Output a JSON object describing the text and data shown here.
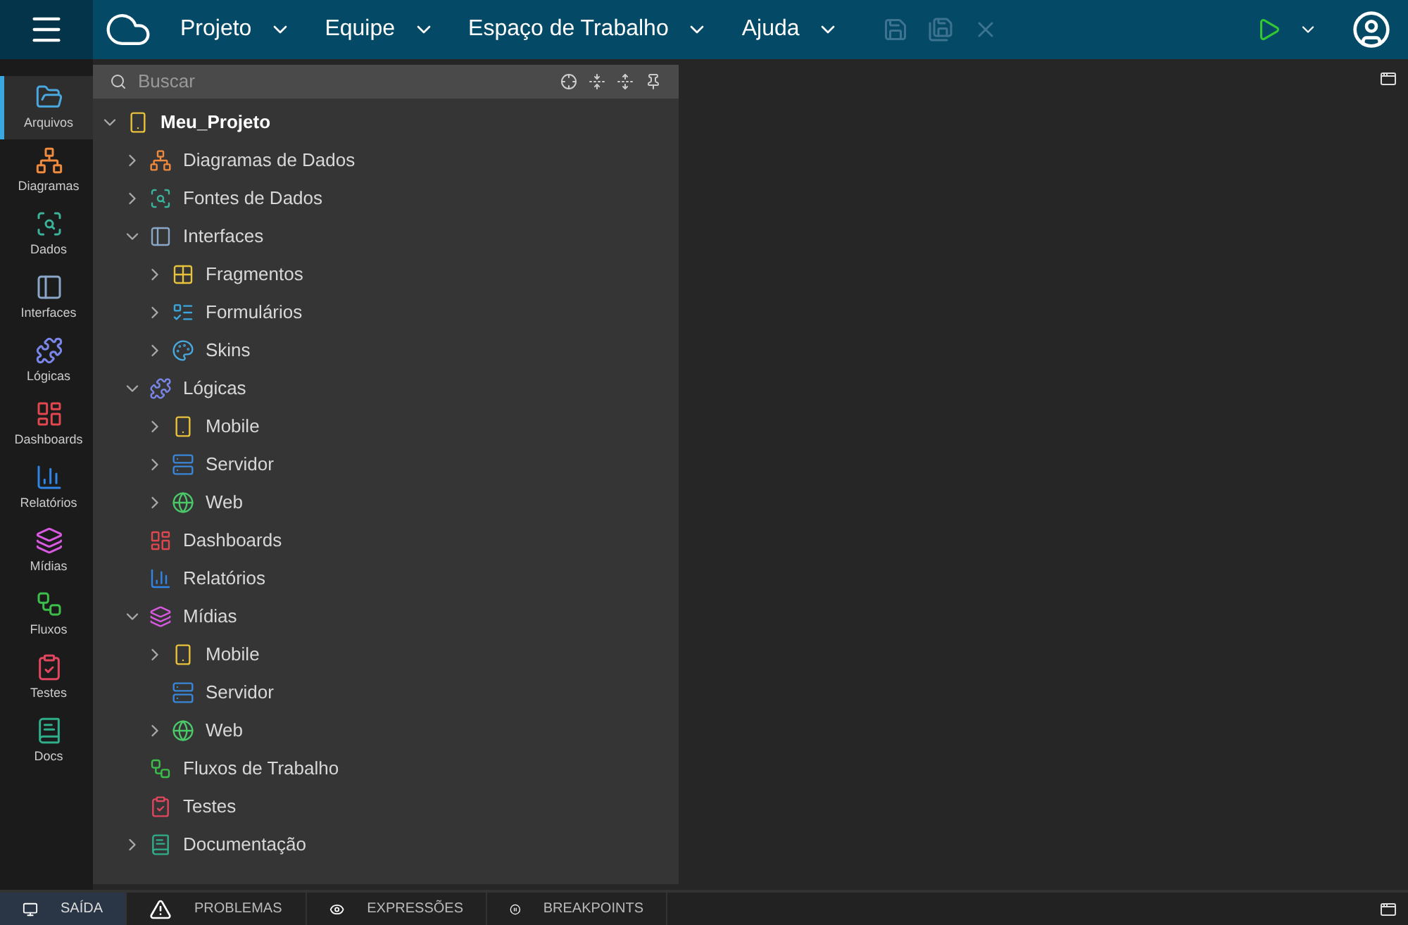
{
  "menu": [
    {
      "label": "Projeto"
    },
    {
      "label": "Equipe"
    },
    {
      "label": "Espaço de Trabalho"
    },
    {
      "label": "Ajuda"
    }
  ],
  "toolbar": [
    {
      "kind": "save",
      "disabled": true
    },
    {
      "kind": "save_all",
      "disabled": true
    },
    {
      "kind": "close",
      "disabled": true
    }
  ],
  "sidebar": {
    "items": [
      {
        "kind": "files",
        "label": "Arquivos",
        "selected": true
      },
      {
        "kind": "diagrams",
        "label": "Diagramas",
        "selected": false
      },
      {
        "kind": "data",
        "label": "Dados",
        "selected": false
      },
      {
        "kind": "interfaces",
        "label": "Interfaces",
        "selected": false
      },
      {
        "kind": "logic",
        "label": "Lógicas",
        "selected": false
      },
      {
        "kind": "dashboards",
        "label": "Dashboards",
        "selected": false
      },
      {
        "kind": "reports",
        "label": "Relatórios",
        "selected": false
      },
      {
        "kind": "media",
        "label": "Mídias",
        "selected": false
      },
      {
        "kind": "flows",
        "label": "Fluxos",
        "selected": false
      },
      {
        "kind": "tests",
        "label": "Testes",
        "selected": false
      },
      {
        "kind": "docs",
        "label": "Docs",
        "selected": false
      }
    ]
  },
  "search": {
    "placeholder": "Buscar"
  },
  "tree": [
    {
      "kind": "mobile",
      "label": "Meu_Projeto",
      "expanded": true,
      "children": [
        {
          "kind": "diagrams",
          "label": "Diagramas de Dados",
          "expanded": false
        },
        {
          "kind": "data",
          "label": "Fontes de Dados",
          "expanded": false
        },
        {
          "kind": "interfaces",
          "label": "Interfaces",
          "expanded": true,
          "children": [
            {
              "kind": "fragments",
              "label": "Fragmentos",
              "expanded": false
            },
            {
              "kind": "forms",
              "label": "Formulários",
              "expanded": false
            },
            {
              "kind": "skins",
              "label": "Skins",
              "expanded": false
            }
          ]
        },
        {
          "kind": "logic",
          "label": "Lógicas",
          "expanded": true,
          "children": [
            {
              "kind": "mobile",
              "label": "Mobile",
              "expanded": false
            },
            {
              "kind": "server",
              "label": "Servidor",
              "expanded": false
            },
            {
              "kind": "web",
              "label": "Web",
              "expanded": false
            }
          ]
        },
        {
          "kind": "dashboards",
          "label": "Dashboards"
        },
        {
          "kind": "reports",
          "label": "Relatórios"
        },
        {
          "kind": "media",
          "label": "Mídias",
          "expanded": true,
          "children": [
            {
              "kind": "mobile",
              "label": "Mobile",
              "expanded": false
            },
            {
              "kind": "server",
              "label": "Servidor"
            },
            {
              "kind": "web",
              "label": "Web",
              "expanded": false
            }
          ]
        },
        {
          "kind": "flows",
          "label": "Fluxos de Trabalho"
        },
        {
          "kind": "tests",
          "label": "Testes"
        },
        {
          "kind": "docs",
          "label": "Documentação",
          "expanded": false
        }
      ]
    }
  ],
  "bottom_tabs": [
    {
      "kind": "output",
      "label": "SAÍDA",
      "selected": true
    },
    {
      "kind": "problems",
      "label": "PROBLEMAS",
      "selected": false
    },
    {
      "kind": "expressions",
      "label": "EXPRESSÕES",
      "selected": false
    },
    {
      "kind": "breakpoints",
      "label": "BREAKPOINTS",
      "selected": false
    }
  ]
}
